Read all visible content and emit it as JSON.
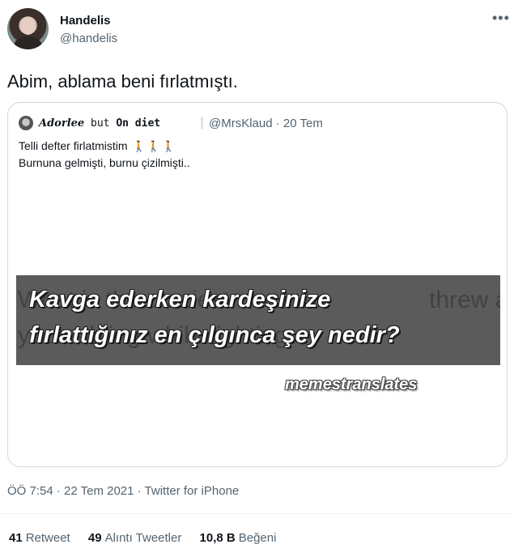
{
  "author": {
    "name": "Handelis",
    "handle": "@handelis",
    "more_icon": "ellipsis-icon"
  },
  "tweet_text": "Abim, ablama beni fırlatmıştı.",
  "quoted": {
    "display_name_italic": "Adorlee",
    "display_name_mid": " but ",
    "display_name_bold": "On diet",
    "handle_date": "@MrsKlaud · 20 Tem",
    "line1": "Telli defter firlatmistim",
    "walkers": "🚶🚶🚶",
    "line2": "Burnuna gelmişti, burnu çizilmişti..",
    "media": {
      "line1": "Kavga ederken kardeşinize",
      "line2": "fırlattığınız en çılgınca şey nedir?",
      "ghost1": "What is the craziest",
      "ghost2": "your sibling while fighting",
      "ghost3": "threw at",
      "watermark": "memestranslates",
      "background": "#5b5b5b"
    }
  },
  "meta": "ÖÖ 7:54 · 22 Tem 2021 · Twitter for iPhone",
  "stats": {
    "retweets_count": "41",
    "retweets_label": "Retweet",
    "quotes_count": "49",
    "quotes_label": "Alıntı Tweetler",
    "likes_count": "10,8 B",
    "likes_label": "Beğeni"
  },
  "colors": {
    "text": "#0f1419",
    "secondary": "#536471",
    "border": "#cfd9de"
  }
}
